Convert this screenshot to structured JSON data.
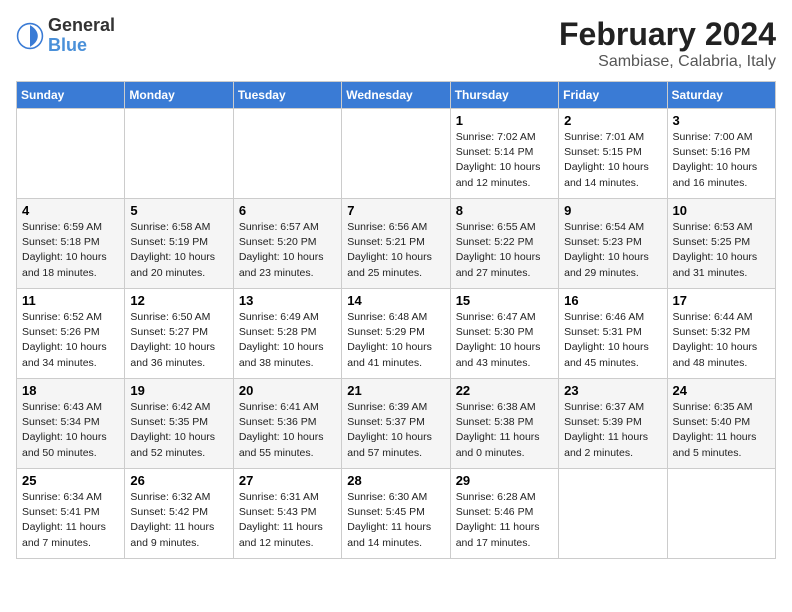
{
  "header": {
    "logo_general": "General",
    "logo_blue": "Blue",
    "month_year": "February 2024",
    "location": "Sambiase, Calabria, Italy"
  },
  "days_of_week": [
    "Sunday",
    "Monday",
    "Tuesday",
    "Wednesday",
    "Thursday",
    "Friday",
    "Saturday"
  ],
  "weeks": [
    [
      {
        "day": "",
        "info": ""
      },
      {
        "day": "",
        "info": ""
      },
      {
        "day": "",
        "info": ""
      },
      {
        "day": "",
        "info": ""
      },
      {
        "day": "1",
        "info": "Sunrise: 7:02 AM\nSunset: 5:14 PM\nDaylight: 10 hours\nand 12 minutes."
      },
      {
        "day": "2",
        "info": "Sunrise: 7:01 AM\nSunset: 5:15 PM\nDaylight: 10 hours\nand 14 minutes."
      },
      {
        "day": "3",
        "info": "Sunrise: 7:00 AM\nSunset: 5:16 PM\nDaylight: 10 hours\nand 16 minutes."
      }
    ],
    [
      {
        "day": "4",
        "info": "Sunrise: 6:59 AM\nSunset: 5:18 PM\nDaylight: 10 hours\nand 18 minutes."
      },
      {
        "day": "5",
        "info": "Sunrise: 6:58 AM\nSunset: 5:19 PM\nDaylight: 10 hours\nand 20 minutes."
      },
      {
        "day": "6",
        "info": "Sunrise: 6:57 AM\nSunset: 5:20 PM\nDaylight: 10 hours\nand 23 minutes."
      },
      {
        "day": "7",
        "info": "Sunrise: 6:56 AM\nSunset: 5:21 PM\nDaylight: 10 hours\nand 25 minutes."
      },
      {
        "day": "8",
        "info": "Sunrise: 6:55 AM\nSunset: 5:22 PM\nDaylight: 10 hours\nand 27 minutes."
      },
      {
        "day": "9",
        "info": "Sunrise: 6:54 AM\nSunset: 5:23 PM\nDaylight: 10 hours\nand 29 minutes."
      },
      {
        "day": "10",
        "info": "Sunrise: 6:53 AM\nSunset: 5:25 PM\nDaylight: 10 hours\nand 31 minutes."
      }
    ],
    [
      {
        "day": "11",
        "info": "Sunrise: 6:52 AM\nSunset: 5:26 PM\nDaylight: 10 hours\nand 34 minutes."
      },
      {
        "day": "12",
        "info": "Sunrise: 6:50 AM\nSunset: 5:27 PM\nDaylight: 10 hours\nand 36 minutes."
      },
      {
        "day": "13",
        "info": "Sunrise: 6:49 AM\nSunset: 5:28 PM\nDaylight: 10 hours\nand 38 minutes."
      },
      {
        "day": "14",
        "info": "Sunrise: 6:48 AM\nSunset: 5:29 PM\nDaylight: 10 hours\nand 41 minutes."
      },
      {
        "day": "15",
        "info": "Sunrise: 6:47 AM\nSunset: 5:30 PM\nDaylight: 10 hours\nand 43 minutes."
      },
      {
        "day": "16",
        "info": "Sunrise: 6:46 AM\nSunset: 5:31 PM\nDaylight: 10 hours\nand 45 minutes."
      },
      {
        "day": "17",
        "info": "Sunrise: 6:44 AM\nSunset: 5:32 PM\nDaylight: 10 hours\nand 48 minutes."
      }
    ],
    [
      {
        "day": "18",
        "info": "Sunrise: 6:43 AM\nSunset: 5:34 PM\nDaylight: 10 hours\nand 50 minutes."
      },
      {
        "day": "19",
        "info": "Sunrise: 6:42 AM\nSunset: 5:35 PM\nDaylight: 10 hours\nand 52 minutes."
      },
      {
        "day": "20",
        "info": "Sunrise: 6:41 AM\nSunset: 5:36 PM\nDaylight: 10 hours\nand 55 minutes."
      },
      {
        "day": "21",
        "info": "Sunrise: 6:39 AM\nSunset: 5:37 PM\nDaylight: 10 hours\nand 57 minutes."
      },
      {
        "day": "22",
        "info": "Sunrise: 6:38 AM\nSunset: 5:38 PM\nDaylight: 11 hours\nand 0 minutes."
      },
      {
        "day": "23",
        "info": "Sunrise: 6:37 AM\nSunset: 5:39 PM\nDaylight: 11 hours\nand 2 minutes."
      },
      {
        "day": "24",
        "info": "Sunrise: 6:35 AM\nSunset: 5:40 PM\nDaylight: 11 hours\nand 5 minutes."
      }
    ],
    [
      {
        "day": "25",
        "info": "Sunrise: 6:34 AM\nSunset: 5:41 PM\nDaylight: 11 hours\nand 7 minutes."
      },
      {
        "day": "26",
        "info": "Sunrise: 6:32 AM\nSunset: 5:42 PM\nDaylight: 11 hours\nand 9 minutes."
      },
      {
        "day": "27",
        "info": "Sunrise: 6:31 AM\nSunset: 5:43 PM\nDaylight: 11 hours\nand 12 minutes."
      },
      {
        "day": "28",
        "info": "Sunrise: 6:30 AM\nSunset: 5:45 PM\nDaylight: 11 hours\nand 14 minutes."
      },
      {
        "day": "29",
        "info": "Sunrise: 6:28 AM\nSunset: 5:46 PM\nDaylight: 11 hours\nand 17 minutes."
      },
      {
        "day": "",
        "info": ""
      },
      {
        "day": "",
        "info": ""
      }
    ]
  ]
}
